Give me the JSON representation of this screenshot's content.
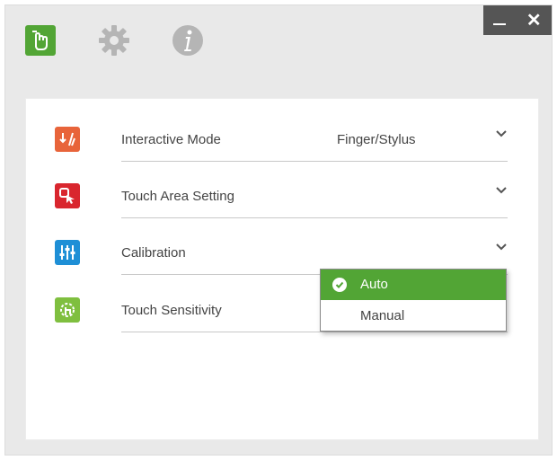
{
  "toolbar": {
    "hand_icon": "touch-hand-icon",
    "gear_icon": "gear-icon",
    "info_icon": "info-icon"
  },
  "window_controls": {
    "minimize_icon": "minimize-icon",
    "close_label": "✕"
  },
  "settings": {
    "rows": [
      {
        "label": "Interactive Mode",
        "value": "Finger/Stylus",
        "icon": "interactive-mode-icon",
        "color": "#e8643a"
      },
      {
        "label": "Touch Area Setting",
        "value": "",
        "icon": "touch-area-icon",
        "color": "#d9262e"
      },
      {
        "label": "Calibration",
        "value": "",
        "icon": "calibration-sliders-icon",
        "color": "#1e8fd6"
      },
      {
        "label": "Touch Sensitivity",
        "value": "",
        "icon": "touch-sensitivity-icon",
        "color": "#7fbf3f"
      }
    ]
  },
  "dropdown": {
    "options": [
      {
        "label": "Auto",
        "selected": true
      },
      {
        "label": "Manual",
        "selected": false
      }
    ]
  },
  "colors": {
    "accent": "#52a535",
    "window_bg": "#e9e9e9",
    "titlebar_control": "#555555"
  }
}
